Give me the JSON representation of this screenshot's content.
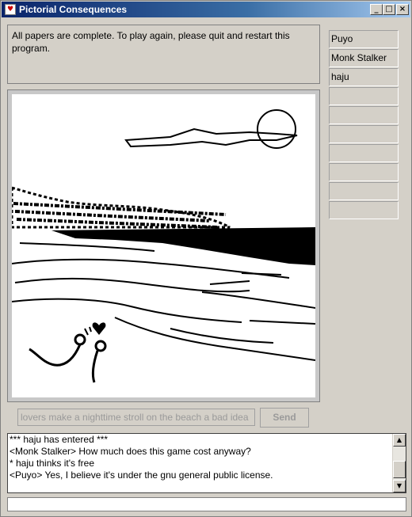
{
  "window": {
    "title": "Pictorial Consequences",
    "minimize": "_",
    "maximize": "□",
    "close": "×"
  },
  "status": {
    "message": "All papers are complete. To play again, please quit and restart this program."
  },
  "players": [
    "Puyo",
    "Monk Stalker",
    "haju",
    "",
    "",
    "",
    "",
    "",
    "",
    ""
  ],
  "caption": {
    "value": "lovers make a nighttime stroll on the beach a bad idea",
    "send_label": "Send"
  },
  "chat": {
    "lines": [
      "*** haju has entered ***",
      "<Monk Stalker> How much does this game cost anyway?",
      "* haju thinks it's free",
      "<Puyo> Yes, I believe it's under the gnu general public license."
    ],
    "input_value": ""
  },
  "icons": {
    "app": "app-icon",
    "scroll_up": "arrow-up-icon",
    "scroll_down": "arrow-down-icon"
  }
}
